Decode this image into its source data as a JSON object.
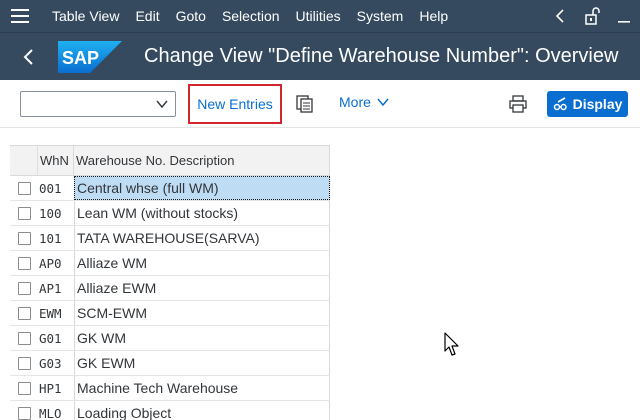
{
  "menubar": {
    "items": [
      "Table View",
      "Edit",
      "Goto",
      "Selection",
      "Utilities",
      "System",
      "Help"
    ],
    "icons": [
      "menu-icon",
      "back-arrow-icon",
      "unlock-icon",
      "minimize-icon"
    ]
  },
  "titlebar": {
    "logo_text": "SAP",
    "title": "Change View \"Define Warehouse Number\": Overview"
  },
  "toolbar": {
    "select_value": "",
    "new_entries_label": "New Entries",
    "more_label": "More",
    "display_label": "Display"
  },
  "table": {
    "columns": [
      "WhN",
      "Warehouse No. Description"
    ],
    "rows": [
      {
        "whn": "001",
        "desc": "Central whse (full WM)"
      },
      {
        "whn": "100",
        "desc": "Lean WM (without stocks)"
      },
      {
        "whn": "101",
        "desc": "TATA WAREHOUSE(SARVA)"
      },
      {
        "whn": "AP0",
        "desc": "Alliaze WM"
      },
      {
        "whn": "AP1",
        "desc": "Alliaze EWM"
      },
      {
        "whn": "EWM",
        "desc": "SCM-EWM"
      },
      {
        "whn": "G01",
        "desc": "GK WM"
      },
      {
        "whn": "G03",
        "desc": "GK EWM"
      },
      {
        "whn": "HP1",
        "desc": "Machine Tech Warehouse"
      },
      {
        "whn": "MLO",
        "desc": "Loading Object"
      }
    ]
  },
  "colors": {
    "shell": "#354a5f",
    "accent": "#0a6ed1",
    "highlight_border": "#d0262d",
    "selected_cell": "#bfdcf5"
  }
}
